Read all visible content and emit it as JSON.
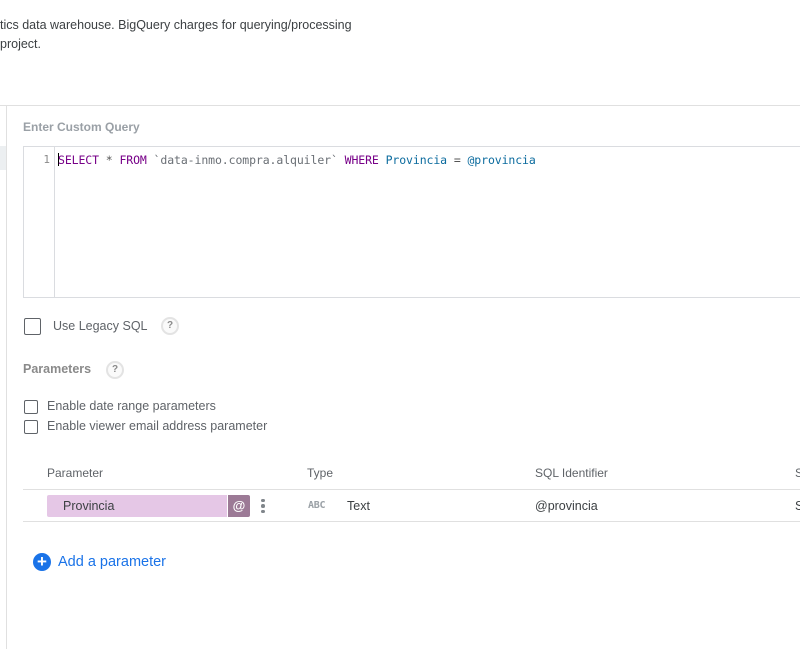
{
  "description": {
    "line1": "tics data warehouse. BigQuery charges for querying/processing",
    "line2": "project."
  },
  "custom_query": {
    "title": "Enter Custom Query",
    "line_number": "1",
    "tokens": {
      "select": "SELECT",
      "star": " * ",
      "from": "FROM",
      "table": " `data-inmo.compra.alquiler` ",
      "where": "WHERE",
      "column": " Provincia ",
      "eq": "= ",
      "param": "@provincia"
    }
  },
  "legacy_sql": {
    "label": "Use Legacy SQL",
    "checked": false,
    "help": "?"
  },
  "parameters": {
    "title": "Parameters",
    "help": "?",
    "date_range_label": "Enable date range parameters",
    "viewer_email_label": "Enable viewer email address parameter"
  },
  "table": {
    "headers": {
      "parameter": "Parameter",
      "type": "Type",
      "sql_identifier": "SQL Identifier",
      "more": "S"
    },
    "rows": [
      {
        "name": "Provincia",
        "at_symbol": "@",
        "type_icon": "ABC",
        "type": "Text",
        "sql_identifier": "@provincia",
        "more": "S"
      }
    ]
  },
  "add_parameter": {
    "icon": "+",
    "label": "Add a parameter"
  },
  "colors": {
    "accent": "#1a73e8",
    "chip": "#e5c7e6",
    "at_button": "#9c7a96",
    "keyword": "#770088"
  }
}
